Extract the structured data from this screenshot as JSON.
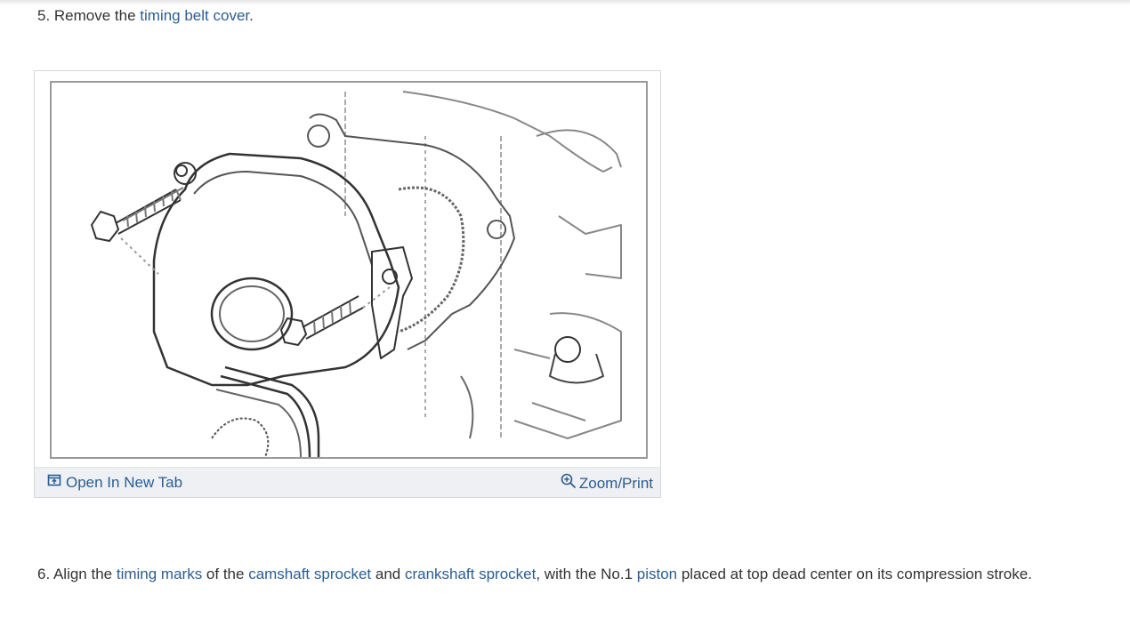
{
  "step5": {
    "text_before": "5. Remove the ",
    "link": "timing belt cover",
    "text_after": "."
  },
  "figure": {
    "open_label": "Open In New Tab",
    "zoom_label": "Zoom/Print",
    "open_icon": "open-in-new-tab-icon",
    "zoom_icon": "zoom-in-icon"
  },
  "step6": {
    "t1": "6. Align the ",
    "l1": "timing marks",
    "t2": " of the ",
    "l2": "camshaft sprocket",
    "t3": " and ",
    "l3": "crankshaft sprocket",
    "t4": ", with the No.1 ",
    "l4": "piston",
    "t5": " placed at top dead center on its compression stroke."
  },
  "colors": {
    "link": "#2b5d91",
    "text": "#333333",
    "bar": "#eef0f3"
  }
}
